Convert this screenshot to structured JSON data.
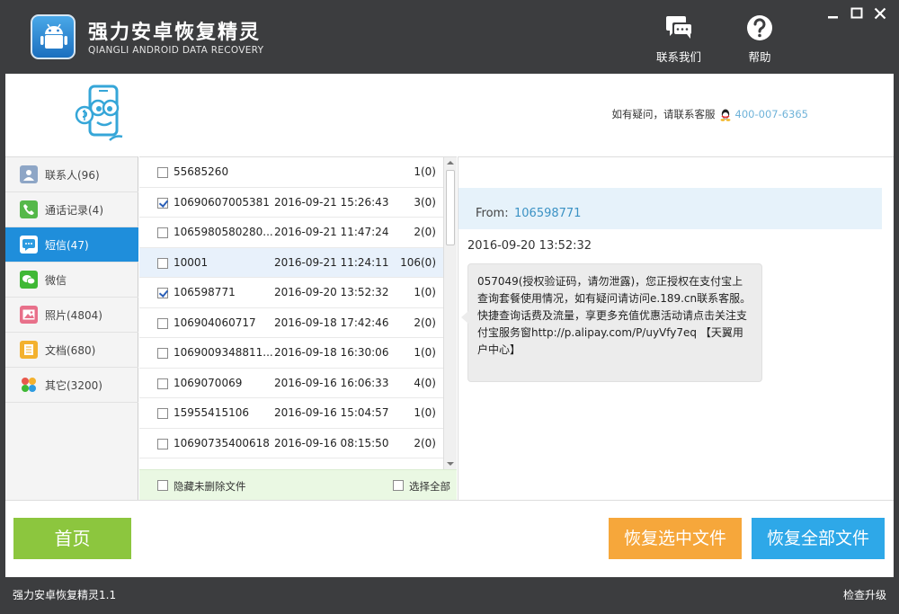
{
  "app": {
    "title": "强力安卓恢复精灵",
    "subtitle": "QIANGLI ANDROID DATA RECOVERY",
    "contact_label": "联系我们",
    "help_label": "帮助"
  },
  "header": {
    "hotline_text": "如有疑问，请联系客服",
    "hotline_number": "400-007-6365"
  },
  "sidebar": {
    "items": [
      {
        "label": "联系人(96)",
        "icon": "contacts-icon",
        "color": "#8ea6c6"
      },
      {
        "label": "通话记录(4)",
        "icon": "phone-icon",
        "color": "#55b84a"
      },
      {
        "label": "短信(47)",
        "icon": "sms-icon",
        "color": "#2d9be0"
      },
      {
        "label": "微信",
        "icon": "wechat-icon",
        "color": "#3fb835"
      },
      {
        "label": "照片(4804)",
        "icon": "photo-icon",
        "color": "#e8708a"
      },
      {
        "label": "文档(680)",
        "icon": "document-icon",
        "color": "#f3b12e"
      },
      {
        "label": "其它(3200)",
        "icon": "other-icon",
        "color": "#e8574c"
      }
    ]
  },
  "messages": {
    "rows": [
      {
        "number": "55685260",
        "date": "",
        "count": "1(0)",
        "checked": false,
        "selected": false
      },
      {
        "number": "10690607005381",
        "date": "2016-09-21 15:26:43",
        "count": "3(0)",
        "checked": true,
        "selected": false
      },
      {
        "number": "1065980580280...",
        "date": "2016-09-21 11:47:24",
        "count": "2(0)",
        "checked": false,
        "selected": false
      },
      {
        "number": "10001",
        "date": "2016-09-21 11:24:11",
        "count": "106(0)",
        "checked": false,
        "selected": true
      },
      {
        "number": "106598771",
        "date": "2016-09-20 13:52:32",
        "count": "1(0)",
        "checked": true,
        "selected": false
      },
      {
        "number": "106904060717",
        "date": "2016-09-18 17:42:46",
        "count": "2(0)",
        "checked": false,
        "selected": false
      },
      {
        "number": "1069009348811...",
        "date": "2016-09-18 16:30:06",
        "count": "1(0)",
        "checked": false,
        "selected": false
      },
      {
        "number": "1069070069",
        "date": "2016-09-16 16:06:33",
        "count": "4(0)",
        "checked": false,
        "selected": false
      },
      {
        "number": "15955415106",
        "date": "2016-09-16 15:04:57",
        "count": "1(0)",
        "checked": false,
        "selected": false
      },
      {
        "number": "10690735400618",
        "date": "2016-09-16 08:15:50",
        "count": "2(0)",
        "checked": false,
        "selected": false
      }
    ],
    "hide_undeleted_label": "隐藏未删除文件",
    "select_all_label": "选择全部"
  },
  "detail": {
    "from_label": "From:",
    "from_value": "106598771",
    "date": "2016-09-20 13:52:32",
    "body": "057049(授权验证码，请勿泄露)，您正授权在支付宝上查询套餐使用情况，如有疑问请访问e.189.cn联系客服。快捷查询话费及流量，享更多充值优惠活动请点击关注支付宝服务窗http://p.alipay.com/P/uyVfy7eq 【天翼用户中心】"
  },
  "actions": {
    "home_label": "首页",
    "restore_selected_label": "恢复选中文件",
    "restore_all_label": "恢复全部文件"
  },
  "status": {
    "version": "强力安卓恢复精灵1.1",
    "update_label": "检查升级"
  }
}
